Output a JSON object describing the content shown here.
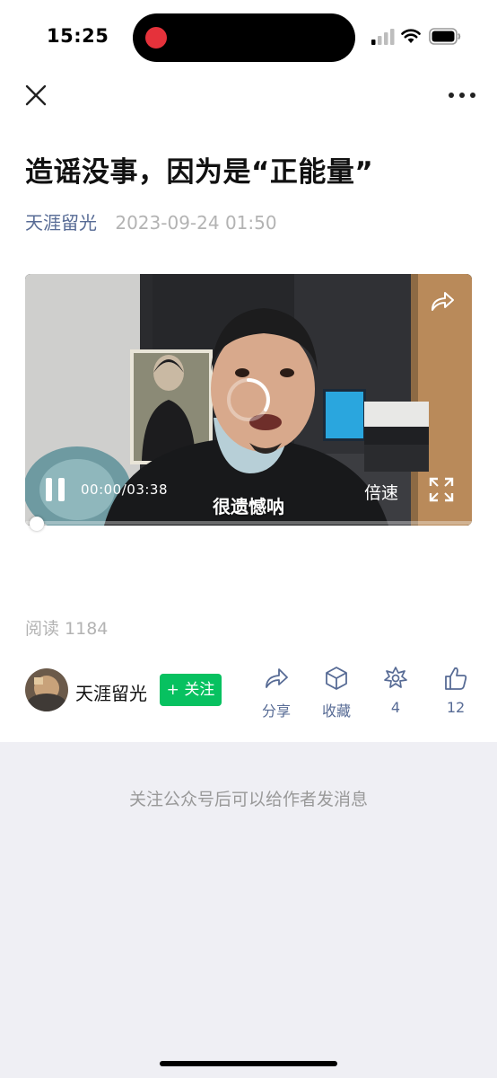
{
  "status_bar": {
    "time": "15:25",
    "icons": [
      "signal-icon",
      "wifi-icon",
      "battery-icon"
    ]
  },
  "nav": {
    "close_icon": "close-icon",
    "more_icon": "more-icon"
  },
  "article": {
    "title": "造谣没事，因为是“正能量”",
    "author": "天涯留光",
    "datetime": "2023-09-24 01:50",
    "read_label": "阅读 1184"
  },
  "video": {
    "time": "00:00/03:38",
    "subtitle": "很遗憾呐",
    "speed_label": "倍速",
    "progress": 0.0
  },
  "author_bar": {
    "name": "天涯留光",
    "follow_label": "+ 关注",
    "actions": [
      {
        "icon": "share-icon",
        "label": "分享"
      },
      {
        "icon": "favorite-icon",
        "label": "收藏"
      },
      {
        "icon": "wow-icon",
        "label": "4"
      },
      {
        "icon": "like-icon",
        "label": "12"
      }
    ]
  },
  "footer": {
    "message": "关注公众号后可以给作者发消息"
  },
  "colors": {
    "link": "#576b95",
    "follow_green": "#07c160",
    "muted": "#b3b3b3",
    "footer_bg": "#efeff4",
    "record_dot": "#e5323b"
  }
}
